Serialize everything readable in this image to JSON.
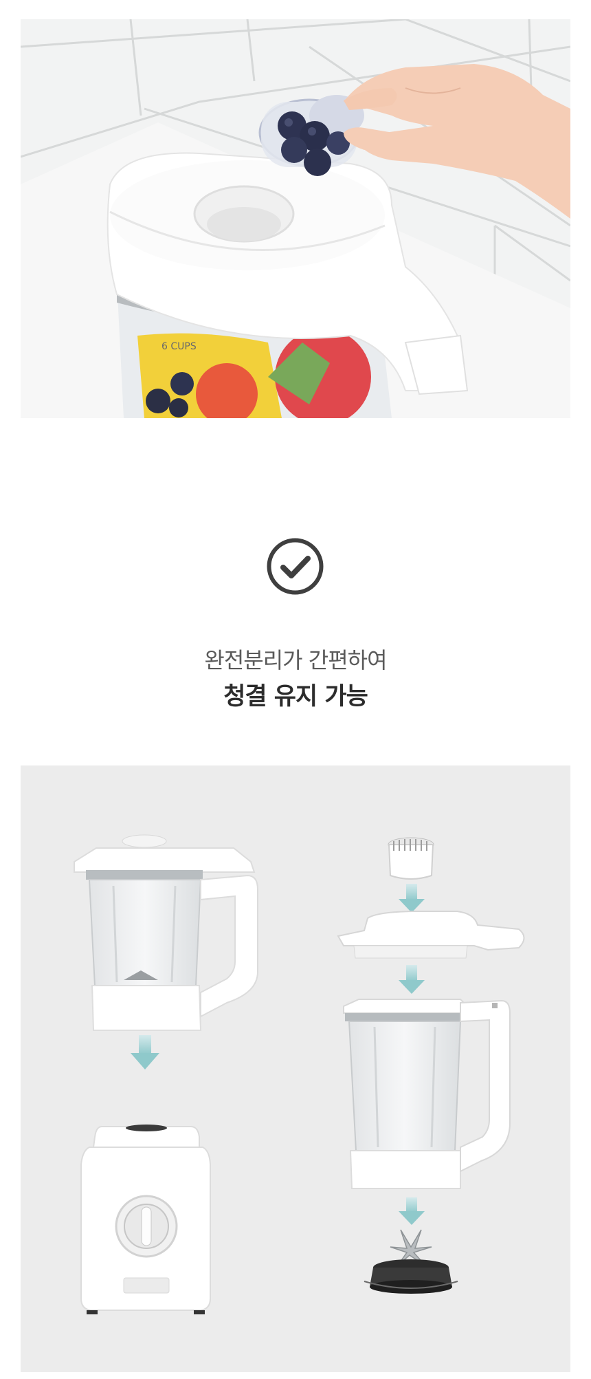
{
  "feature": {
    "check_icon": "check-circle-icon",
    "text_line1": "완전분리가 간편하여",
    "text_line2": "청결 유지 가능"
  },
  "photo_top": {
    "cup_label": "6 CUPS"
  }
}
